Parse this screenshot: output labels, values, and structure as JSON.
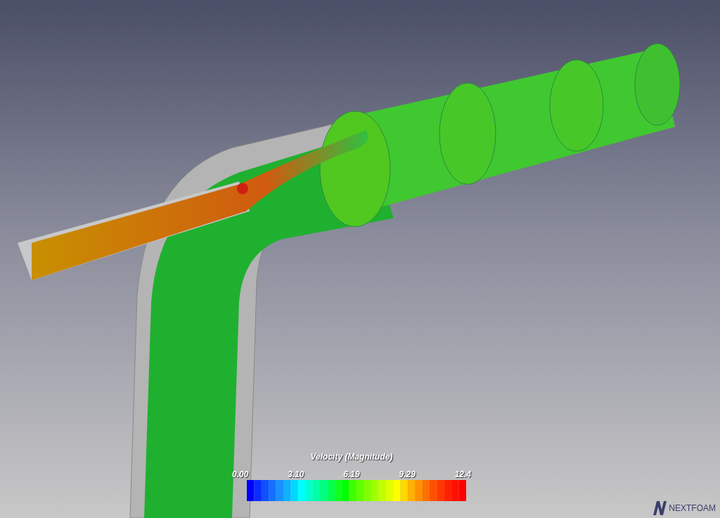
{
  "legend": {
    "title": "Velocity (Magnitude)",
    "ticks": [
      "0.00",
      "3.10",
      "6.19",
      "9.29",
      "12.4"
    ]
  },
  "logo": {
    "text": "NEXTFOAM"
  }
}
